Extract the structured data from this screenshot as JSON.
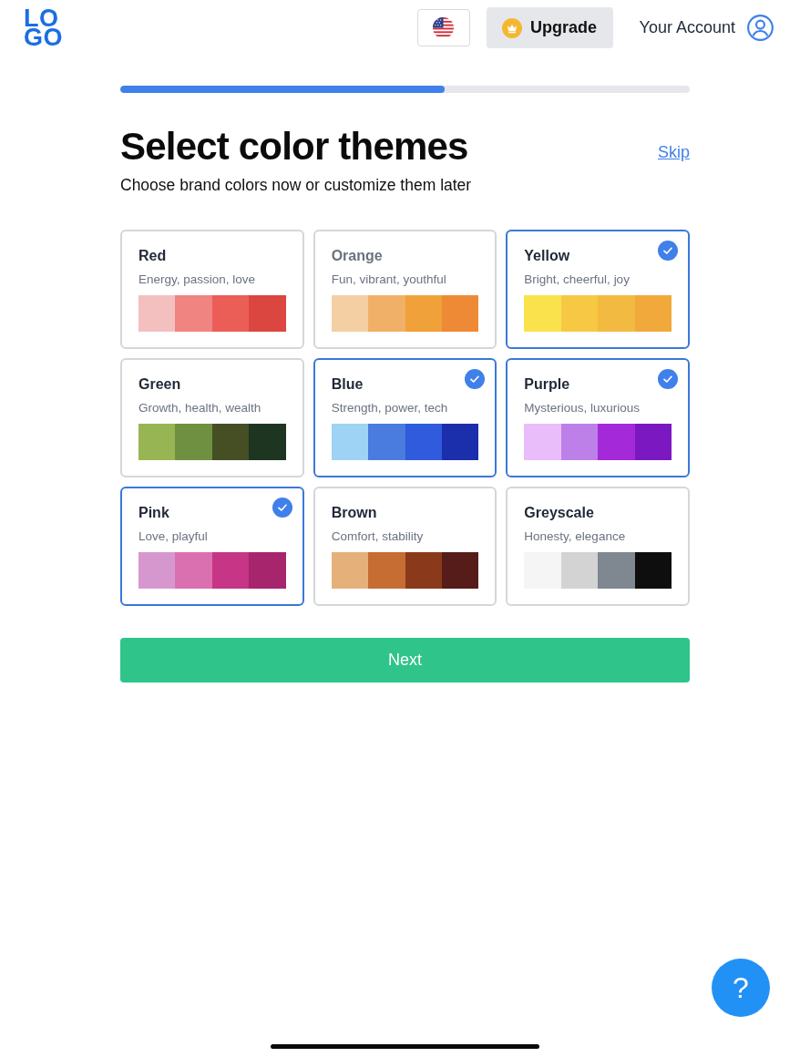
{
  "header": {
    "logo": [
      "LO",
      "GO"
    ],
    "upgrade_label": "Upgrade",
    "account_label": "Your Account"
  },
  "progress": {
    "level": 0.57
  },
  "title": "Select color themes",
  "subtitle": "Choose brand colors now or customize them later",
  "skip_label": "Skip",
  "themes": [
    {
      "name": "Red",
      "description": "Energy, passion, love",
      "selected": false,
      "dimmed": false,
      "swatches": [
        {
          "color": "#f4bfbf"
        },
        {
          "color": "#ef8480"
        },
        {
          "color": "#eb5e57"
        },
        {
          "color": "#dc4640"
        }
      ]
    },
    {
      "name": "Orange",
      "description": "Fun, vibrant, youthful",
      "selected": false,
      "dimmed": true,
      "swatches": [
        {
          "color": "#f4cfa4"
        },
        {
          "color": "#f1b067"
        },
        {
          "color": "#f0a13a"
        },
        {
          "color": "#ee8a35"
        }
      ]
    },
    {
      "name": "Yellow",
      "description": "Bright, cheerful, joy",
      "selected": true,
      "dimmed": false,
      "swatches": [
        {
          "color": "#f9e24c"
        },
        {
          "color": "#f7c843"
        },
        {
          "color": "#f3ba41"
        },
        {
          "color": "#f0a93a"
        }
      ]
    },
    {
      "name": "Green",
      "description": "Growth, health, wealth",
      "selected": false,
      "dimmed": false,
      "swatches": [
        {
          "color": "#97b553"
        },
        {
          "color": "#6f9040"
        },
        {
          "color": "#454f23"
        },
        {
          "color": "#1e3522"
        }
      ]
    },
    {
      "name": "Blue",
      "description": "Strength, power, tech",
      "selected": true,
      "dimmed": false,
      "swatches": [
        {
          "color": "#9ed3f5"
        },
        {
          "color": "#4a7bdf"
        },
        {
          "color": "#2f5bdc"
        },
        {
          "color": "#1b2eac"
        }
      ]
    },
    {
      "name": "Purple",
      "description": "Mysterious, luxurious",
      "selected": true,
      "dimmed": false,
      "swatches": [
        {
          "color": "#e8bdf9"
        },
        {
          "color": "#bd80e8"
        },
        {
          "color": "#a42ad9"
        },
        {
          "color": "#7b18c2"
        }
      ]
    },
    {
      "name": "Pink",
      "description": "Love, playful",
      "selected": true,
      "dimmed": false,
      "swatches": [
        {
          "color": "#d697ce"
        },
        {
          "color": "#db70b0"
        },
        {
          "color": "#c63586"
        },
        {
          "color": "#a6256c"
        }
      ]
    },
    {
      "name": "Brown",
      "description": "Comfort, stability",
      "selected": false,
      "dimmed": false,
      "swatches": [
        {
          "color": "#e6b07b"
        },
        {
          "color": "#c56d32"
        },
        {
          "color": "#8a3a1a"
        },
        {
          "color": "#551c1a"
        }
      ]
    },
    {
      "name": "Greyscale",
      "description": "Honesty, elegance",
      "selected": false,
      "dimmed": false,
      "swatches": [
        {
          "color": "#f5f5f5"
        },
        {
          "color": "#d3d3d3"
        },
        {
          "color": "#7f8791"
        },
        {
          "color": "#0e0e0e"
        }
      ]
    }
  ],
  "next_label": "Next",
  "help_label": "?"
}
